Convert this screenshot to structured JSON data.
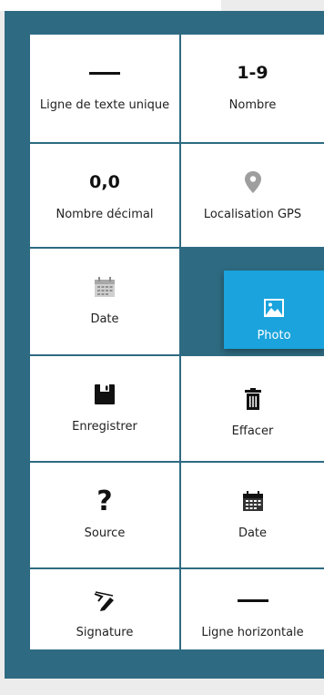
{
  "palette": {
    "panel": "#2e6b82",
    "cell": "#ffffff",
    "accent": "#1aa3dc",
    "icon_gray": "#9e9e9e"
  },
  "fields": [
    {
      "label": "Ligne de texte unique",
      "icon": "horizontal-line-icon"
    },
    {
      "label": "Nombre",
      "icon_text": "1-9"
    },
    {
      "label": "Nombre décimal",
      "icon_text": "0,0"
    },
    {
      "label": "Localisation GPS",
      "icon": "map-pin-icon"
    },
    {
      "label": "Date",
      "icon": "calendar-icon"
    },
    {
      "label": "",
      "icon": "empty-slot"
    },
    {
      "label": "Enregistrer",
      "icon": "floppy-disk-icon"
    },
    {
      "label": "Effacer",
      "icon": "trash-icon"
    },
    {
      "label": "Source",
      "icon_text": "?"
    },
    {
      "label": "Date",
      "icon": "calendar-icon"
    },
    {
      "label": "Signature",
      "icon": "pen-signature-icon"
    },
    {
      "label": "Ligne horizontale",
      "icon": "horizontal-line-icon"
    }
  ],
  "dragging": {
    "label": "Photo",
    "icon": "image-icon"
  }
}
